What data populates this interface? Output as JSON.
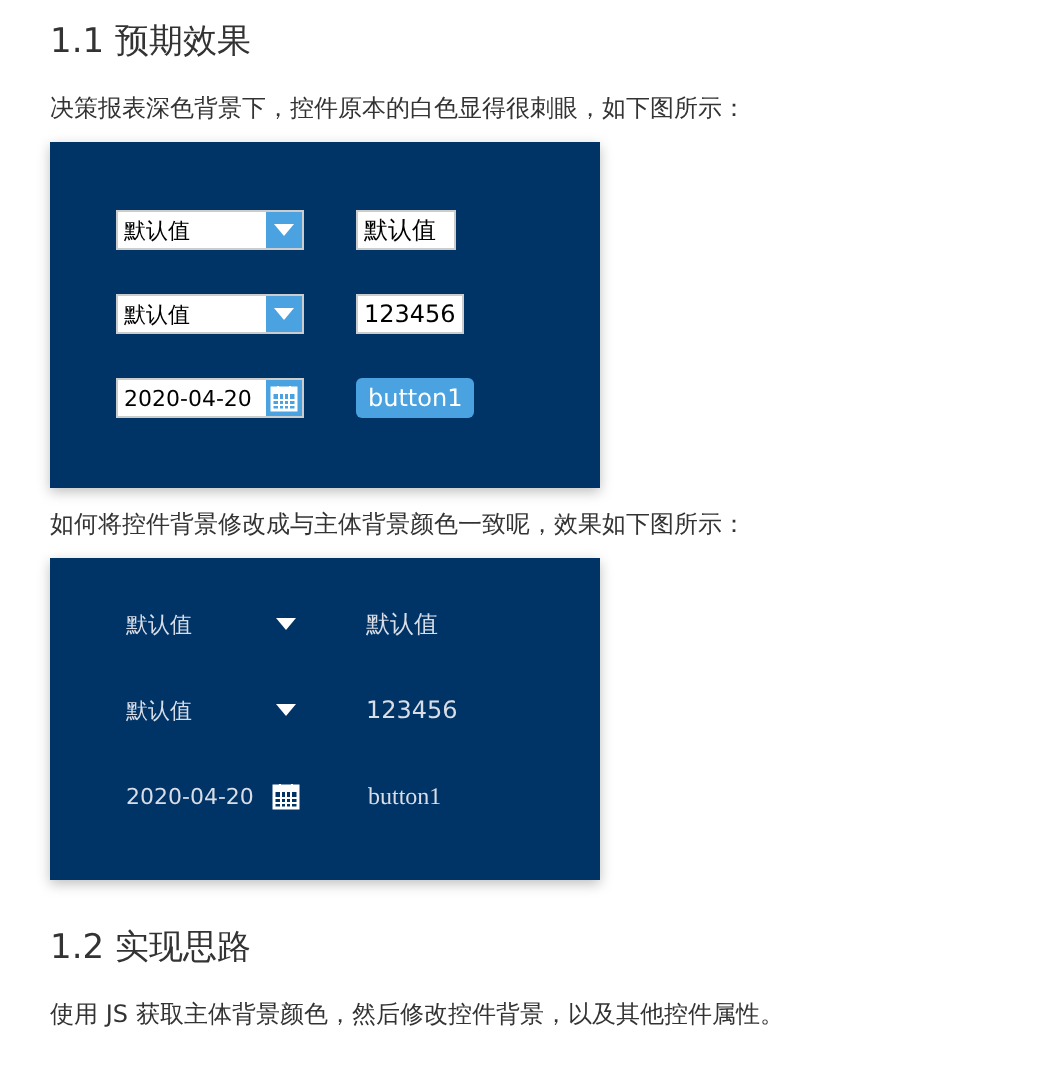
{
  "sections": [
    {
      "heading": "1.1 预期效果",
      "blocks": [
        {
          "kind": "paragraph",
          "text": "决策报表深色背景下，控件原本的白色显得很刺眼，如下图所示："
        },
        {
          "kind": "panel",
          "rows": [
            [
              {
                "kind": "combo",
                "value": "默认值"
              },
              {
                "kind": "text",
                "value": "默认值"
              }
            ],
            [
              {
                "kind": "combo",
                "value": "默认值"
              },
              {
                "kind": "text",
                "value": "123456"
              }
            ],
            [
              {
                "kind": "date",
                "value": "2020-04-20"
              },
              {
                "kind": "button",
                "label": "button1"
              }
            ]
          ]
        },
        {
          "kind": "paragraph",
          "text": "如何将控件背景修改成与主体背景颜色一致呢，效果如下图所示："
        },
        {
          "kind": "flatpanel",
          "rows": [
            [
              {
                "kind": "combo",
                "value": "默认值"
              },
              {
                "kind": "text",
                "value": "默认值"
              }
            ],
            [
              {
                "kind": "combo",
                "value": "默认值"
              },
              {
                "kind": "text",
                "value": "123456"
              }
            ],
            [
              {
                "kind": "date",
                "value": "2020-04-20"
              },
              {
                "kind": "button",
                "label": "button1"
              }
            ]
          ]
        }
      ]
    },
    {
      "heading": "1.2 实现思路",
      "blocks": [
        {
          "kind": "paragraph",
          "text": "使用 JS 获取主体背景颜色，然后修改控件背景，以及其他控件属性。"
        }
      ]
    }
  ]
}
